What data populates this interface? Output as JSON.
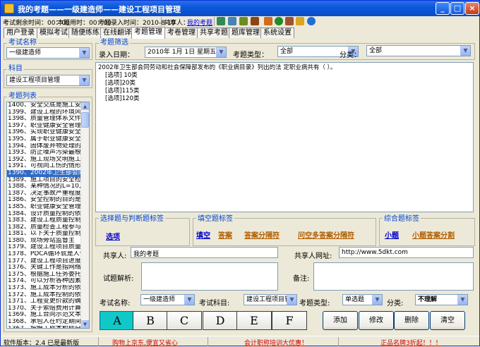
{
  "window": {
    "title": "我的考题——一级建造师——建设工程项目管理",
    "min_label": "_",
    "max_label": "□",
    "close_label": "×"
  },
  "info": {
    "remaining_time": "考试剩余时间：00：00",
    "used_time": "本题用时：00：00",
    "entry_time": "考题录入时间：2010-8-10",
    "sharer_label": "共享人：",
    "sharer_link": "我的考题"
  },
  "tabs": [
    "用户登录",
    "模拟考试",
    "随便练练",
    "在线翻译",
    "考题管理",
    "考卷管理",
    "共享考题",
    "题库管理",
    "系统设置"
  ],
  "left": {
    "exam_name_label": "考试名称",
    "exam_name_value": "一级建造师",
    "subject_label": "科目",
    "subject_value": "建设工程项目管理",
    "list_label": "考题列表",
    "items": [
      "1400、安全交底是施工安",
      "1399、建设工程的环境风",
      "1398、质量管理体系文件",
      "1397、职业健康安全管理",
      "1396、实现职业健康安全",
      "1395、属于职业健康安全",
      "1394、固体废弃物处理的",
      "1393、防止噪声污染最根",
      "1392、施工现场文明施工",
      "1391、可视同工伤的情形",
      "1390、2002年卫生部会同",
      "1389、施工项目的安全检",
      "1388、某种情况的L=10,",
      "1387、决定事故严重程度",
      "1386、安全控制的目的是",
      "1385、职业健康安全管理",
      "1384、设计质量控制的依",
      "1383、建设工程质量控制",
      "1382、质量检查工程参与",
      "1381、以下关于质量控制",
      "1380、现场旁站监督主",
      "1379、建设工程项目质量",
      "1378、PDCA循环就是人们",
      "1377、建设工程项目进度",
      "1376、关键工作是指网络",
      "1375、根据施工任务委托",
      "1374、可以分析各种因素",
      "1373、施工成本分析的依",
      "1372、施工成本控制的依",
      "1371、工程变更价款的确",
      "1370、关于索赔费用计算",
      "1369、施工合同示范文本",
      "1368、承包人在约定期间",
      "1367、按施工成本构成分",
      "1366、成本管理责任",
      "1365、建设项目实施阶段"
    ],
    "selected_index": 10
  },
  "filter": {
    "group_label": "考题筛选",
    "date_label": "录入日期：",
    "date_value": "2010年  1月  1日  星期五",
    "type_label": "考题类型：",
    "type_value": "全部",
    "category_label": "分类：",
    "category_value": "全部"
  },
  "question": {
    "text": "2002年卫生部会同劳动和社会保障部发布的《职业病目录》列出的法 定职业病共有（    ）。",
    "options": [
      "[选项] 10类",
      "[选项]20类",
      "[选项]115类",
      "[选项]120类"
    ]
  },
  "tags": {
    "choice_label": "选择题与判断题标签",
    "choice_items": [
      "选项"
    ],
    "fill_label": "填空题标签",
    "fill_items": [
      "填空",
      "答案",
      "答案分隔符",
      "问空多答案分隔符"
    ],
    "combo_label": "综合题标签",
    "combo_items": [
      "小题",
      "小题答案分割"
    ]
  },
  "form": {
    "sharer_label": "共享人:",
    "sharer_value": "我的考题",
    "url_label": "共享人网址:",
    "url_value": "http://www.5dkt.com",
    "analysis_label": "试题解析:",
    "analysis_value": "",
    "note_label": "备注:",
    "note_value": "",
    "exam_label": "考试名称:",
    "exam_value": "一级建造师",
    "subject_label": "考试科目:",
    "subject_value": "建设工程项目管",
    "qtype_label": "考题类型:",
    "qtype_value": "单选题",
    "cat_label": "分类:",
    "cat_value": "不理解"
  },
  "answers": [
    "A",
    "B",
    "C",
    "D",
    "E",
    "F"
  ],
  "actions": {
    "add": "添加",
    "modify": "修改",
    "delete": "删除",
    "clear": "清空"
  },
  "status": {
    "version": "软件版本：2.4 已是最新版",
    "ad1": "购物上京东,便宜又省心",
    "ad2": "会计职称培训大优惠！",
    "ad3": "正品名牌3折起！！！"
  },
  "colors": {
    "titlebar": "#0B58DC",
    "selection": "#316AC5",
    "answer_on": "#10C8C8",
    "tag_link": "#B25E00",
    "group_label": "#0046D5"
  }
}
